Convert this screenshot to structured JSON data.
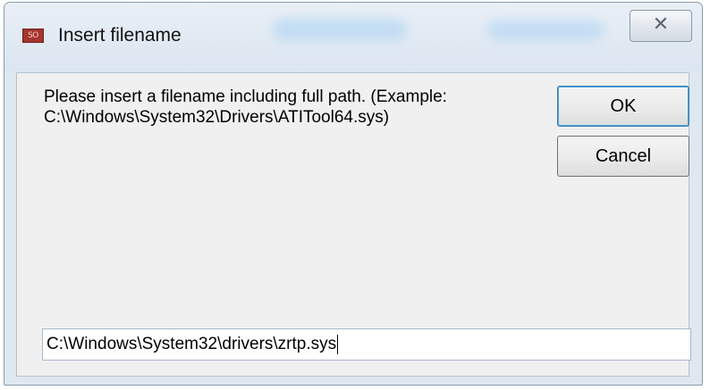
{
  "window": {
    "title": "Insert filename",
    "app_icon_text": "SO",
    "close_glyph": "✕"
  },
  "dialog": {
    "message_line1": "Please insert a filename including full path. (Example:",
    "message_line2": "C:\\Windows\\System32\\Drivers\\ATITool64.sys)",
    "ok_label": "OK",
    "cancel_label": "Cancel",
    "filename_value": "C:\\Windows\\System32\\drivers\\zrtp.sys"
  },
  "icons": {
    "app": "app-icon",
    "close": "close-icon"
  },
  "colors": {
    "frame": "#dfe7f1",
    "client": "#f0f0f0",
    "focus_border": "#3c7fb1",
    "app_icon": "#a4362f"
  }
}
